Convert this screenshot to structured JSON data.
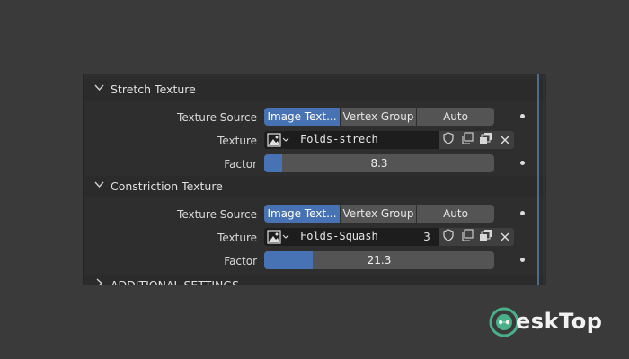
{
  "sections": [
    {
      "title": "Stretch Texture",
      "texture_source_label": "Texture Source",
      "source_options": [
        "Image Text...",
        "Vertex Group",
        "Auto"
      ],
      "active_source_index": 0,
      "texture_label": "Texture",
      "texture_name": "Folds-strech",
      "texture_users": "",
      "factor_label": "Factor",
      "factor_value": "8.3",
      "factor_fill": 0.08
    },
    {
      "title": "Constriction Texture",
      "texture_source_label": "Texture Source",
      "source_options": [
        "Image Text...",
        "Vertex Group",
        "Auto"
      ],
      "active_source_index": 0,
      "texture_label": "Texture",
      "texture_name": "Folds-Squash",
      "texture_users": "3",
      "factor_label": "Factor",
      "factor_value": "21.3",
      "factor_fill": 0.21
    }
  ],
  "additional_settings_title": "ADDITIONAL SETTINGS",
  "watermark": {
    "text": "eskTop"
  },
  "colors": {
    "accent": "#4772b3",
    "panel": "#2e2e2e",
    "background": "#3a3a3a"
  },
  "icons": [
    "chevron-down-icon",
    "image-texture-icon",
    "fake-user-shield-icon",
    "duplicate-icon",
    "new-texture-icon",
    "close-icon",
    "chevron-right-icon"
  ]
}
